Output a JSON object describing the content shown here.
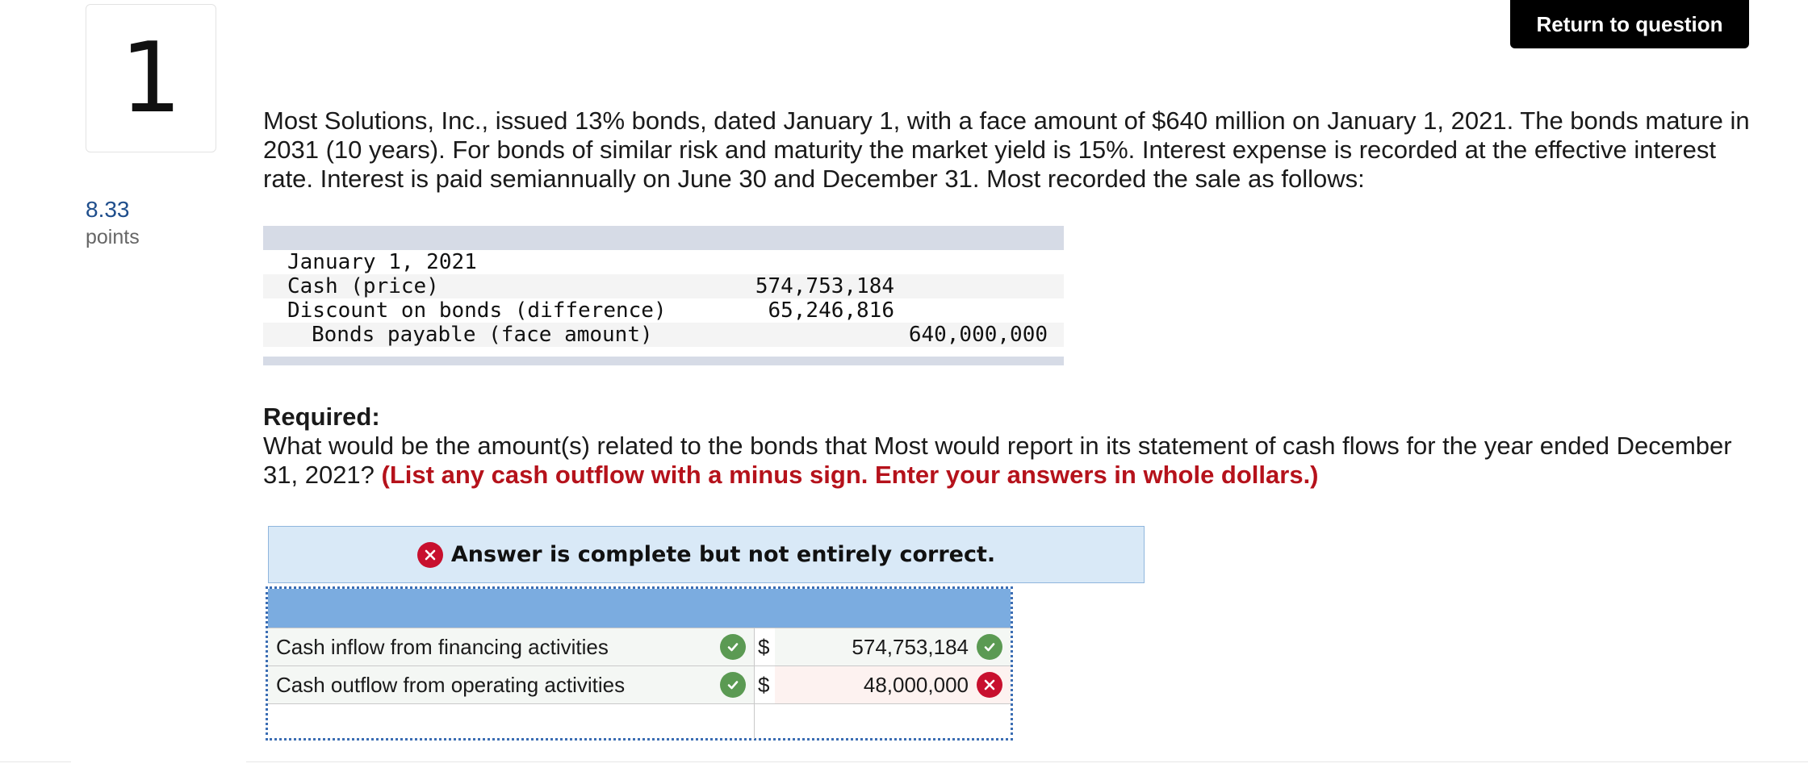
{
  "question": {
    "number": "1",
    "points_value": "8.33",
    "points_label": "points",
    "return_button": "Return to question"
  },
  "intro_text": "Most Solutions, Inc., issued 13% bonds, dated January 1, with a face amount of $640 million on January 1, 2021. The bonds mature in 2031 (10 years). For bonds of similar risk and maturity the market yield is 15%. Interest expense is recorded at the effective interest rate. Interest is paid semiannually on June 30 and December 31. Most recorded the sale as follows:",
  "journal": {
    "date": "January 1, 2021",
    "rows": [
      {
        "desc": "Cash (price)",
        "debit": "574,753,184",
        "credit": ""
      },
      {
        "desc": "Discount on bonds (difference)",
        "debit": "65,246,816",
        "credit": ""
      },
      {
        "desc": "Bonds payable (face amount)",
        "debit": "",
        "credit": "640,000,000"
      }
    ]
  },
  "required": {
    "title": "Required:",
    "text": "What would be the amount(s) related to the bonds that Most would report in its statement of cash flows for the year ended December 31, 2021? ",
    "instruction": "(List any cash outflow with a minus sign. Enter your answers in whole dollars.)"
  },
  "banner": {
    "text": "Answer is complete but not entirely correct.",
    "icon": "x-circle-icon"
  },
  "answer_table": {
    "rows": [
      {
        "label": "Cash inflow from financing activities",
        "currency": "$",
        "amount": "574,753,184",
        "label_status": "correct",
        "amount_status": "correct"
      },
      {
        "label": "Cash outflow from operating activities",
        "currency": "$",
        "amount": "48,000,000",
        "label_status": "correct",
        "amount_status": "incorrect"
      }
    ]
  },
  "colors": {
    "correct": "#5b9a53",
    "incorrect": "#c8102e",
    "table_header": "#7bace0",
    "banner_bg": "#d9e9f7",
    "instruction_red": "#b5121b",
    "points_blue": "#1f4e8c"
  }
}
